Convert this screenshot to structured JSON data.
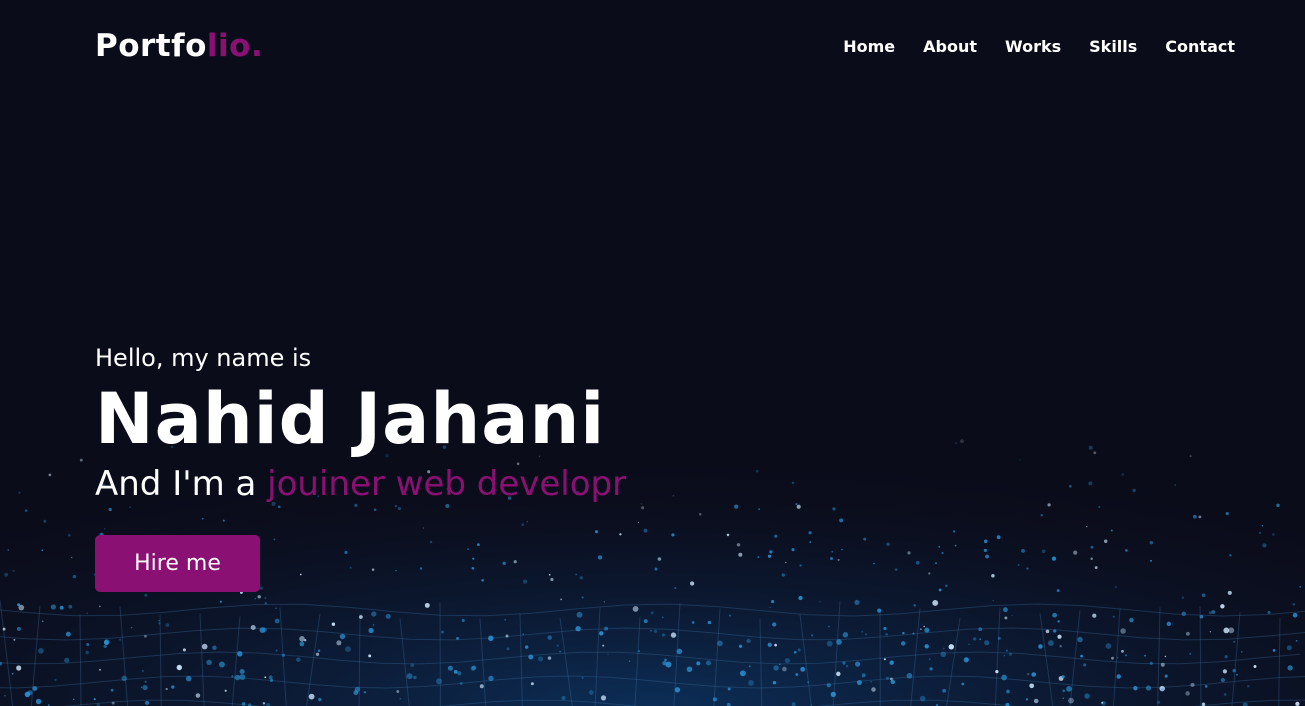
{
  "nav": {
    "logo_main": "Portfo",
    "logo_accent": "lio.",
    "items": [
      {
        "label": "Home"
      },
      {
        "label": "About"
      },
      {
        "label": "Works"
      },
      {
        "label": "Skills"
      },
      {
        "label": "Contact"
      }
    ]
  },
  "hero": {
    "greeting": "Hello, my name is",
    "name": "Nahid Jahani",
    "role_prefix": "And I'm a ",
    "role_highlight": "jouiner web developr",
    "cta_label": "Hire me"
  },
  "colors": {
    "background": "#0b0c1a",
    "accent": "#8a1173",
    "text": "#ffffff",
    "particles": "#2a8fd0"
  }
}
